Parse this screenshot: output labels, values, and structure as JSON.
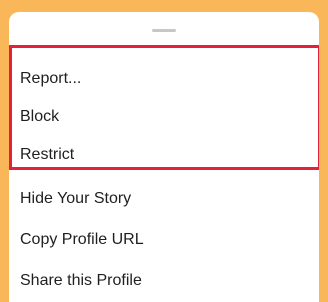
{
  "menu": {
    "items": [
      {
        "label": "Report..."
      },
      {
        "label": "Block"
      },
      {
        "label": "Restrict"
      },
      {
        "label": "Hide Your Story"
      },
      {
        "label": "Copy Profile URL"
      },
      {
        "label": "Share this Profile"
      }
    ]
  },
  "colors": {
    "background": "#f9b75a",
    "sheet": "#ffffff",
    "highlight_border": "#e1223a",
    "text": "#1f1f1f",
    "handle": "#c7c7c7"
  }
}
